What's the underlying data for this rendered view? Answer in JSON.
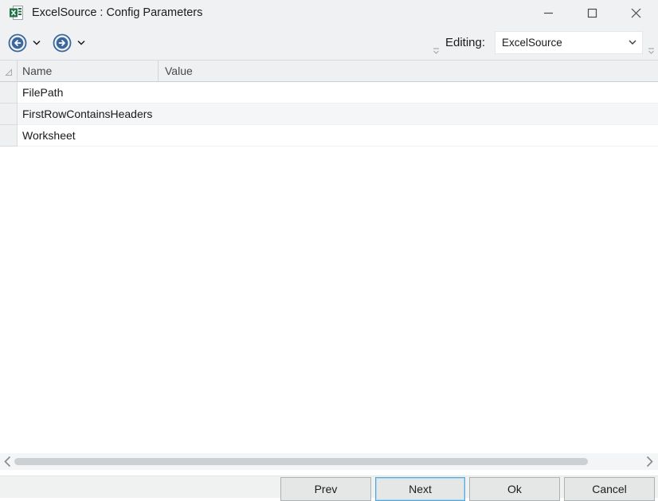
{
  "window": {
    "title": "ExcelSource : Config Parameters"
  },
  "toolbar": {
    "editing_label": "Editing:",
    "editing_value": "ExcelSource"
  },
  "grid": {
    "columns": {
      "name": "Name",
      "value": "Value"
    },
    "rows": [
      {
        "name": "FilePath",
        "value": ""
      },
      {
        "name": "FirstRowContainsHeaders",
        "value": ""
      },
      {
        "name": "Worksheet",
        "value": ""
      }
    ]
  },
  "footer": {
    "prev": "Prev",
    "next": "Next",
    "ok": "Ok",
    "cancel": "Cancel"
  },
  "icons": {
    "app": "excel-file-icon",
    "back": "circled-left-arrow",
    "forward": "circled-right-arrow",
    "dropdown": "chevron-down",
    "overflow": "toolbar-overflow-chevron",
    "minimize": "minus",
    "maximize": "square",
    "close": "x",
    "select_all": "corner-triangle",
    "scroll_left": "chevron-left",
    "scroll_right": "chevron-right"
  },
  "colors": {
    "nav_blue": "#3a679c",
    "excel_green": "#217346",
    "focus_border": "#56a9dc",
    "chrome_bg": "#eff1f2",
    "header_bg": "#eef0f1",
    "alt_row_bg": "#f4f6f8"
  }
}
